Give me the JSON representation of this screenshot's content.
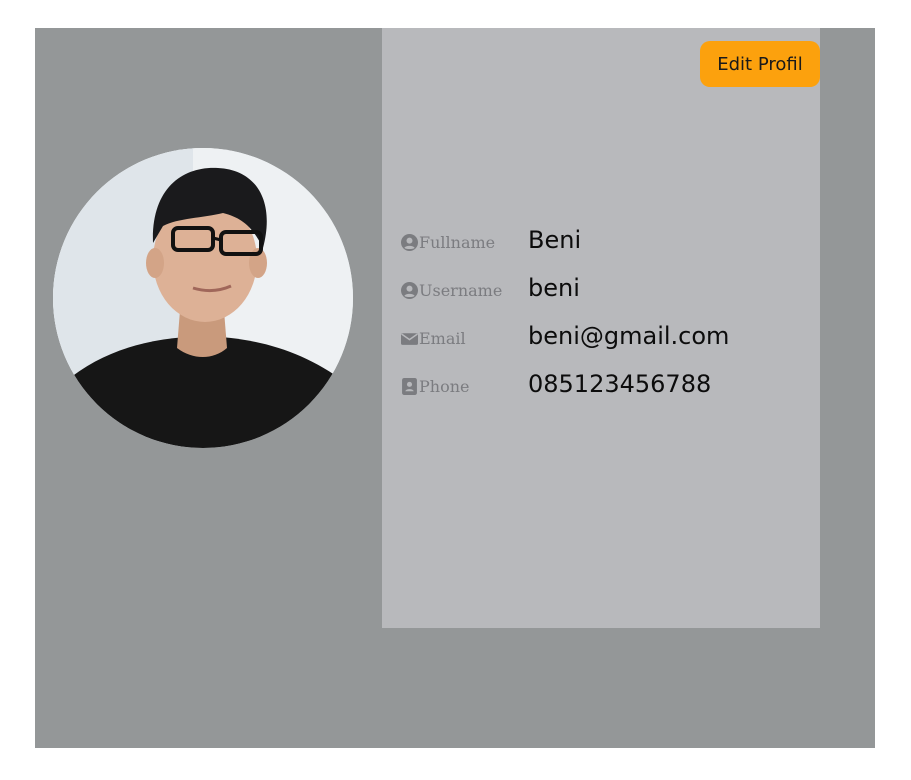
{
  "profile": {
    "edit_button": "Edit Profil",
    "avatar_alt": "profile photo",
    "fields": [
      {
        "label": "Fullname",
        "value": "Beni",
        "icon": "user-circle-icon"
      },
      {
        "label": "Username",
        "value": "beni",
        "icon": "user-circle-icon"
      },
      {
        "label": "Email",
        "value": "beni@gmail.com",
        "icon": "envelope-icon"
      },
      {
        "label": "Phone",
        "value": "085123456788",
        "icon": "contact-card-icon"
      }
    ]
  },
  "colors": {
    "outer_bg": "#949798",
    "panel_bg": "#b8b9bc",
    "accent": "#fca10d",
    "label": "#7b7c80"
  }
}
